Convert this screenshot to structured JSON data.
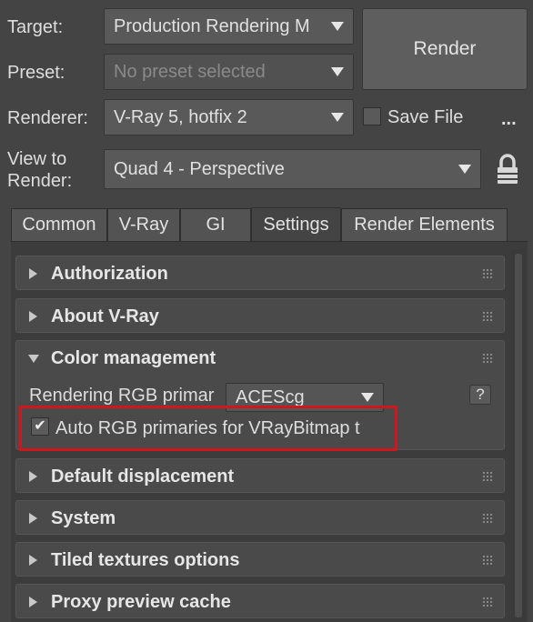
{
  "header": {
    "target_label": "Target:",
    "target_value": "Production Rendering M",
    "preset_label": "Preset:",
    "preset_value": "No preset selected",
    "renderer_label": "Renderer:",
    "renderer_value": "V-Ray 5, hotfix 2",
    "view_label_line1": "View to",
    "view_label_line2": "Render:",
    "view_value": "Quad 4 - Perspective",
    "render_button": "Render",
    "save_file_label": "Save File",
    "save_file_checked": false,
    "more_button": "...",
    "lock_icon": "lock-icon"
  },
  "tabs": [
    {
      "label": "Common",
      "active": false
    },
    {
      "label": "V-Ray",
      "active": false
    },
    {
      "label": "GI",
      "active": false
    },
    {
      "label": "Settings",
      "active": true
    },
    {
      "label": "Render Elements",
      "active": false
    }
  ],
  "rollouts": {
    "authorization": "Authorization",
    "about": "About V-Ray",
    "color_management": "Color management",
    "default_displacement": "Default displacement",
    "system": "System",
    "tiled_textures": "Tiled textures options",
    "proxy_preview": "Proxy preview cache"
  },
  "color_management": {
    "primaries_label": "Rendering RGB primar",
    "primaries_value": "ACEScg",
    "help_button": "?",
    "auto_rgb_label": "Auto RGB primaries for VRayBitmap t",
    "auto_rgb_checked": true,
    "check_glyph": "✔"
  },
  "colors": {
    "highlight_box": "#d0161e",
    "background": "#444444",
    "panel": "#3c3c3c"
  }
}
